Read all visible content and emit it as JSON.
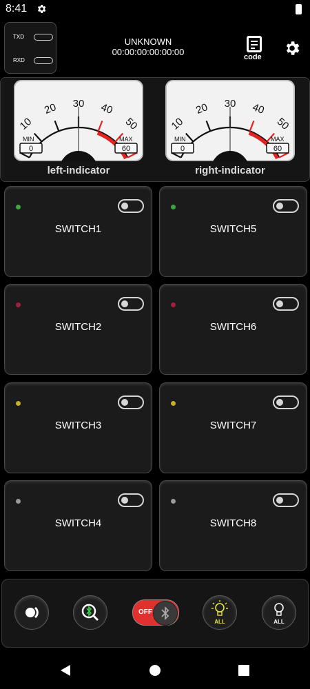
{
  "status_bar": {
    "time": "8:41"
  },
  "comm": {
    "tx_label": "TXD",
    "rx_label": "RXD"
  },
  "connection": {
    "name": "UNKNOWN",
    "address": "00:00:00:00:00:00"
  },
  "header": {
    "code_label": "code"
  },
  "meters": [
    {
      "label": "left-indicator",
      "scale": [
        "10",
        "20",
        "30",
        "40",
        "50"
      ],
      "min_label": "MIN",
      "max_label": "MAX",
      "min_value": "0",
      "max_value": "60",
      "value": 0
    },
    {
      "label": "right-indicator",
      "scale": [
        "10",
        "20",
        "30",
        "40",
        "50"
      ],
      "min_label": "MIN",
      "max_label": "MAX",
      "min_value": "0",
      "max_value": "60",
      "value": 0
    }
  ],
  "switches": [
    {
      "label": "SWITCH1",
      "led_color": "#3aa83a",
      "on": false
    },
    {
      "label": "SWITCH2",
      "led_color": "#a0203a",
      "on": false
    },
    {
      "label": "SWITCH3",
      "led_color": "#c6b02a",
      "on": false
    },
    {
      "label": "SWITCH4",
      "led_color": "#9a9a9a",
      "on": false
    },
    {
      "label": "SWITCH5",
      "led_color": "#3aa83a",
      "on": false
    },
    {
      "label": "SWITCH6",
      "led_color": "#a0203a",
      "on": false
    },
    {
      "label": "SWITCH7",
      "led_color": "#c6b02a",
      "on": false
    },
    {
      "label": "SWITCH8",
      "led_color": "#9a9a9a",
      "on": false
    }
  ],
  "bottom": {
    "bt_toggle_label": "OFF",
    "all_on_label": "ALL",
    "all_off_label": "ALL",
    "all_on_color": "#e8e83a"
  }
}
